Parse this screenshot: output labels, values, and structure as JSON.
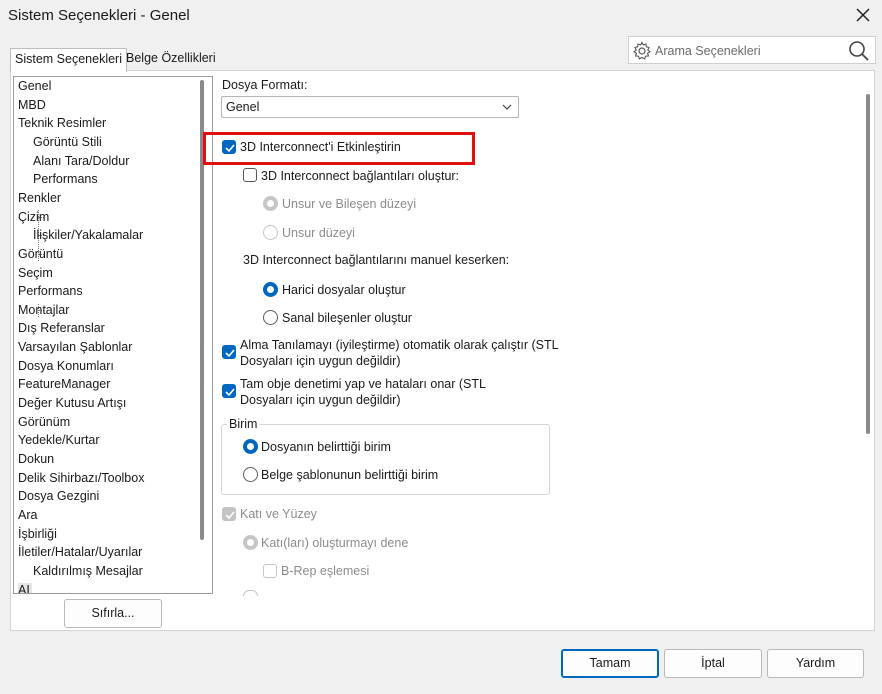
{
  "window": {
    "title": "Sistem Seçenekleri - Genel"
  },
  "tabs": [
    {
      "label": "Sistem Seçenekleri"
    },
    {
      "label": "Belge Özellikleri"
    }
  ],
  "search": {
    "placeholder": "Arama Seçenekleri"
  },
  "tree": {
    "items": [
      {
        "label": "Genel",
        "level": 0
      },
      {
        "label": "MBD",
        "level": 0
      },
      {
        "label": "Teknik Resimler",
        "level": 0
      },
      {
        "label": "Görüntü Stili",
        "level": 1
      },
      {
        "label": "Alanı Tara/Doldur",
        "level": 1
      },
      {
        "label": "Performans",
        "level": 1
      },
      {
        "label": "Renkler",
        "level": 0
      },
      {
        "label": "Çizim",
        "level": 0
      },
      {
        "label": "İlişkiler/Yakalamalar",
        "level": 1
      },
      {
        "label": "Görüntü",
        "level": 0
      },
      {
        "label": "Seçim",
        "level": 0
      },
      {
        "label": "Performans",
        "level": 0
      },
      {
        "label": "Montajlar",
        "level": 0
      },
      {
        "label": "Dış Referanslar",
        "level": 0
      },
      {
        "label": "Varsayılan Şablonlar",
        "level": 0
      },
      {
        "label": "Dosya Konumları",
        "level": 0
      },
      {
        "label": "FeatureManager",
        "level": 0
      },
      {
        "label": "Değer Kutusu Artışı",
        "level": 0
      },
      {
        "label": "Görünüm",
        "level": 0
      },
      {
        "label": "Yedekle/Kurtar",
        "level": 0
      },
      {
        "label": "Dokun",
        "level": 0
      },
      {
        "label": "Delik Sihirbazı/Toolbox",
        "level": 0
      },
      {
        "label": "Dosya Gezgini",
        "level": 0
      },
      {
        "label": "Ara",
        "level": 0
      },
      {
        "label": "İşbirliği",
        "level": 0
      },
      {
        "label": "İletiler/Hatalar/Uyarılar",
        "level": 0
      },
      {
        "label": "Kaldırılmış Mesajlar",
        "level": 1
      },
      {
        "label": "AI",
        "level": 0
      }
    ]
  },
  "reset_label": "Sıfırla...",
  "options": {
    "file_format_label": "Dosya Formatı:",
    "file_format_value": "Genel",
    "enable_3d_interconnect": {
      "label": "3D Interconnect'i Etkinleştirin",
      "checked": true
    },
    "create_links": {
      "label": "3D Interconnect bağlantıları oluştur:",
      "checked": false
    },
    "feature_level": {
      "label": "Unsur ve Bileşen düzeyi",
      "selected": true
    },
    "unsur_level": {
      "label": "Unsur düzeyi",
      "selected": false
    },
    "manual_break_label": "3D Interconnect bağlantılarını manuel keserken:",
    "external_files": {
      "label": "Harici dosyalar oluştur",
      "selected": true
    },
    "virtual_components": {
      "label": "Sanal bileşenler oluştur",
      "selected": false
    },
    "auto_heal": {
      "line1": "Alma Tanılamayı (iyileştirme) otomatik olarak çalıştır (STL",
      "line2": "Dosyaları için uygun değildir)",
      "checked": true
    },
    "full_check": {
      "line1": "Tam obje denetimi yap ve hataları onar (STL",
      "line2": "Dosyaları için uygun değildir)",
      "checked": true
    },
    "unit_group_label": "Birim",
    "unit_file": {
      "label": "Dosyanın belirttiği birim",
      "selected": true
    },
    "unit_template": {
      "label": "Belge şablonunun belirttiği birim",
      "selected": false
    },
    "solid_surface": {
      "label": "Katı ve Yüzey",
      "checked": true
    },
    "try_solid": {
      "label": "Katı(ları) oluşturmayı dene",
      "selected": true
    },
    "brep": {
      "label": "B-Rep eşlemesi",
      "checked": false
    }
  },
  "footer": {
    "ok": "Tamam",
    "cancel": "İptal",
    "help": "Yardım"
  },
  "colors": {
    "accent": "#0067c0",
    "highlight": "#e01010"
  }
}
